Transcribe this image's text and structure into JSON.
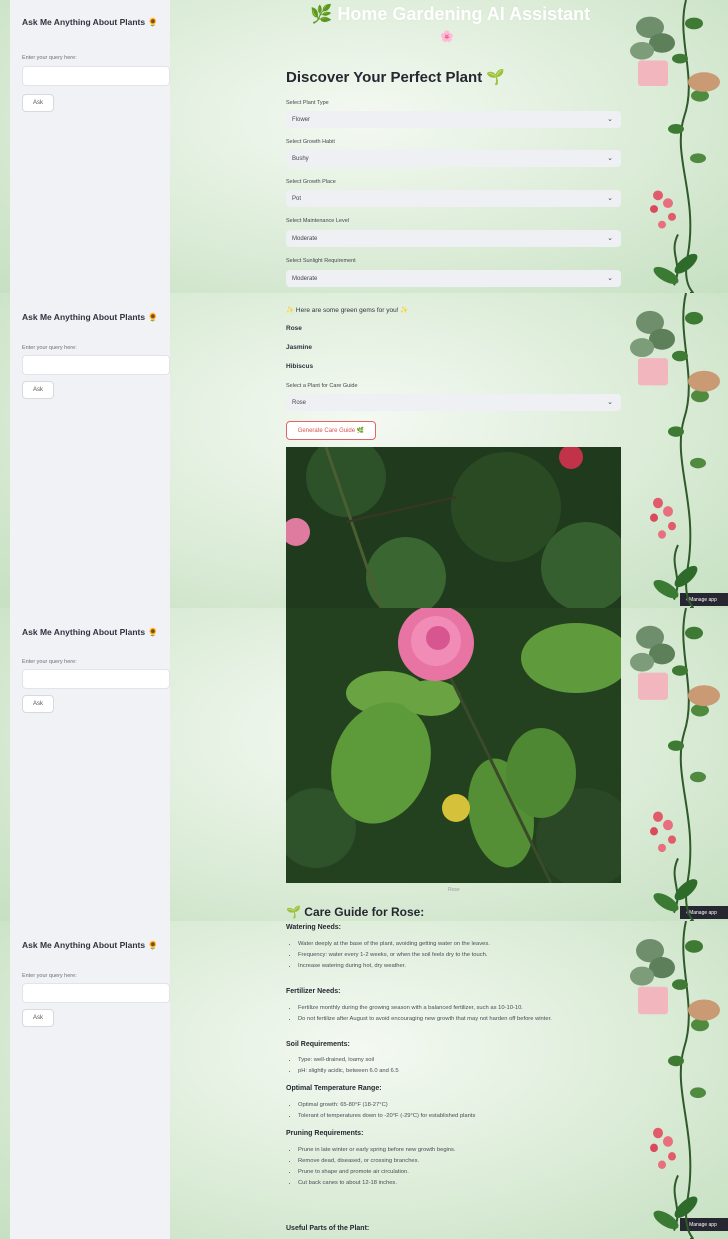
{
  "app": {
    "title": "🌿 Home Gardening AI Assistant",
    "flower_emoji": "🌸"
  },
  "sidebar": {
    "title": "Ask Me Anything About Plants 🌻",
    "query_label": "Enter your query here:",
    "ask_label": "Ask"
  },
  "discover": {
    "heading": "Discover Your Perfect Plant 🌱",
    "fields": [
      {
        "label": "Select Plant Type",
        "value": "Flower"
      },
      {
        "label": "Select Growth Habit",
        "value": "Bushy"
      },
      {
        "label": "Select Growth Place",
        "value": "Pot"
      },
      {
        "label": "Select Maintenance Level",
        "value": "Moderate"
      },
      {
        "label": "Select Sunlight Requirement",
        "value": "Moderate"
      }
    ]
  },
  "results": {
    "banner": "✨ Here are some green gems for you! ✨",
    "plants": [
      "Rose",
      "Jasmine",
      "Hibiscus"
    ],
    "care_select_label": "Select a Plant for Care Guide",
    "care_select_value": "Rose",
    "generate_label": "Generate Care Guide 🌿",
    "photo_caption": "Rose"
  },
  "care_guide": {
    "heading": "🌱 Care Guide for Rose:",
    "sections": [
      {
        "title": "Watering Needs:",
        "items": [
          "Water deeply at the base of the plant, avoiding getting water on the leaves.",
          "Frequency: water every 1-2 weeks, or when the soil feels dry to the touch.",
          "Increase watering during hot, dry weather."
        ]
      },
      {
        "title": "Fertilizer Needs:",
        "items": [
          "Fertilize monthly during the growing season with a balanced fertilizer, such as 10-10-10.",
          "Do not fertilize after August to avoid encouraging new growth that may not harden off before winter."
        ]
      },
      {
        "title": "Soil Requirements:",
        "items": [
          "Type: well-drained, loamy soil",
          "pH: slightly acidic, between 6.0 and 6.5"
        ]
      },
      {
        "title": "Optimal Temperature Range:",
        "items": [
          "Optimal growth: 65-80°F (18-27°C)",
          "Tolerant of temperatures down to -20°F (-29°C) for established plants"
        ]
      },
      {
        "title": "Pruning Requirements:",
        "items": [
          "Prune in late winter or early spring before new growth begins.",
          "Remove dead, diseased, or crossing branches.",
          "Prune to shape and promote air circulation.",
          "Cut back canes to about 12-18 inches."
        ]
      },
      {
        "title": "Useful Parts of the Plant:",
        "items": []
      }
    ]
  },
  "manage_app": "Manage app"
}
